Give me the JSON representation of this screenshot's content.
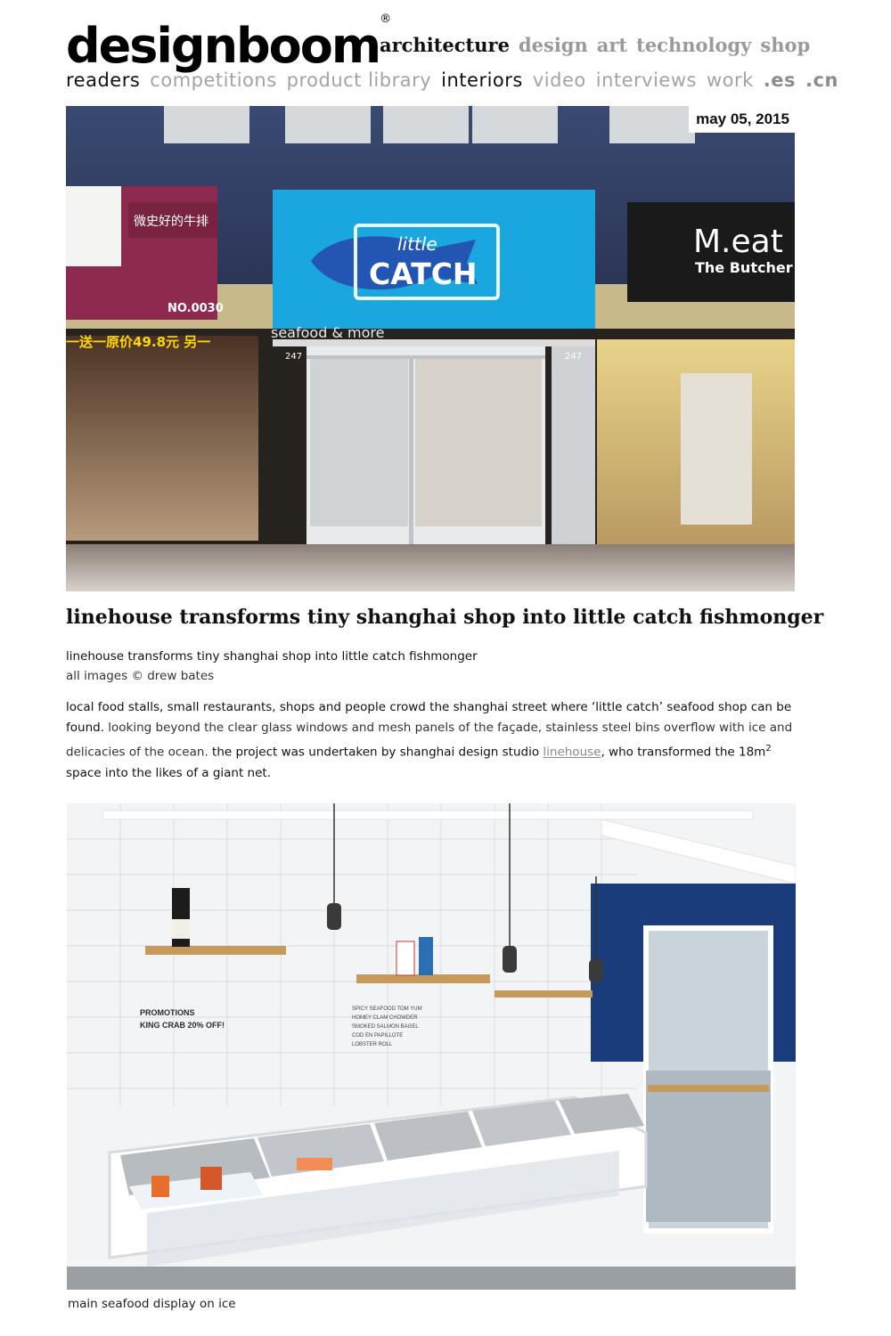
{
  "header": {
    "logo": "designboom",
    "logo_mark": "®",
    "nav_primary": [
      "architecture",
      "design",
      "art",
      "technology",
      "shop"
    ],
    "nav_secondary": [
      "readers",
      "competitions",
      "product library",
      "interiors",
      "video",
      "interviews",
      "work",
      ".es",
      ".cn"
    ]
  },
  "hero": {
    "date": "may 05, 2015",
    "signs": {
      "catch_top": "little",
      "catch_main": "CATCH",
      "tagline": "seafood & more",
      "meat_main": "M.eat",
      "meat_sub": "The Butcher",
      "shop_number": "NO.0030",
      "door_number_left": "247",
      "door_number_right": "247"
    }
  },
  "article": {
    "title": "linehouse transforms tiny shanghai shop into little catch fishmonger",
    "subtitle": "linehouse transforms tiny shanghai shop into little catch fishmonger",
    "credit": "all images © drew bates",
    "p1": "local food stalls, small restaurants, shops and people crowd the shanghai street where ‘little catch’ seafood shop can be found.",
    "p2": " looking beyond the clear glass windows and mesh panels of the façade, stainless steel bins overflow with ice and delicacies of the ocean.",
    "p3": " the project was undertaken by shanghai design studio ",
    "link": "linehouse",
    "p4": ", who transformed the 18m",
    "sup": "2",
    "p5": " space into the likes of a giant net."
  },
  "photo2": {
    "promo_line1": "PROMOTIONS",
    "promo_line2": "KING CRAB 20% OFF!",
    "menu_items": [
      "SPICY SEAFOOD TOM YUM",
      "HOMEY CLAM CHOWDER",
      "SMOKED SALMON BAGEL",
      "COD EN PAPILLOTE",
      "LOBSTER ROLL"
    ],
    "caption": "main seafood display on ice"
  },
  "colors": {
    "accent_blue": "#1aa7e0",
    "nav_active": "#111111",
    "nav_inactive": "#9a9a9a"
  }
}
